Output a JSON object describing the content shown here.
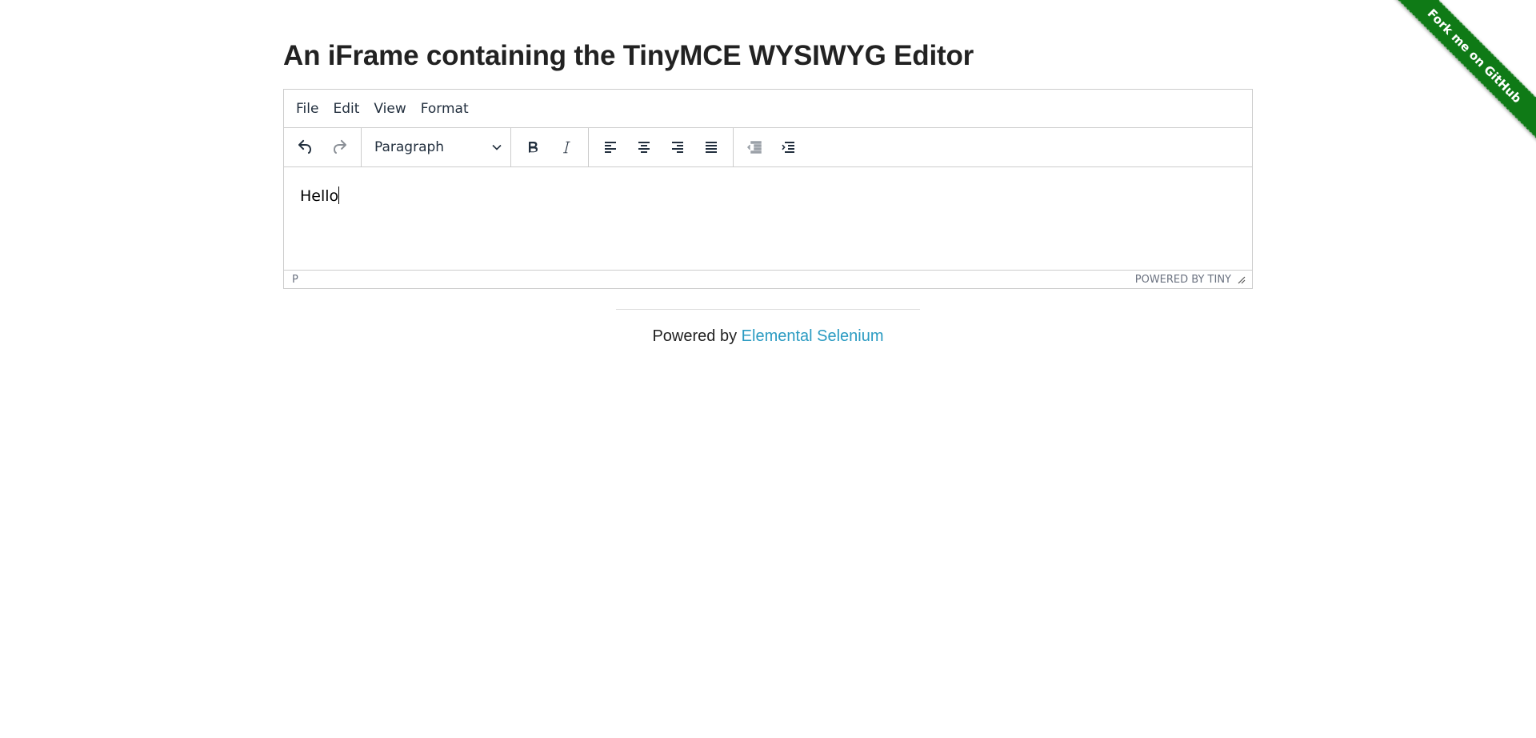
{
  "ribbon": {
    "label": "Fork me on GitHub",
    "color": "#0f7a16"
  },
  "page": {
    "title": "An iFrame containing the TinyMCE WYSIWYG Editor"
  },
  "editor": {
    "menubar": [
      "File",
      "Edit",
      "View",
      "Format"
    ],
    "toolbar": {
      "history": [
        "undo-icon",
        "redo-icon"
      ],
      "block_format": "Paragraph",
      "formatting": [
        "bold-icon",
        "italic-icon"
      ],
      "alignment": [
        "align-left-icon",
        "align-center-icon",
        "align-right-icon",
        "align-justify-icon"
      ],
      "indentation": [
        "outdent-icon",
        "indent-icon"
      ]
    },
    "content_text": "Hello",
    "status_path": "P",
    "branding": "POWERED BY TINY"
  },
  "footer": {
    "prefix": "Powered by",
    "link_label": "Elemental Selenium",
    "link_color": "#2b9bc2"
  }
}
